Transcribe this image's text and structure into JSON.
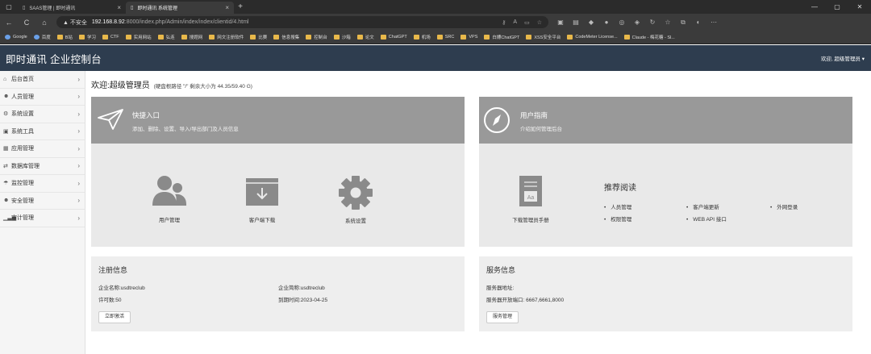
{
  "browser": {
    "tabs": [
      {
        "title": "SAAS管理 | 即时通讯",
        "close": "×"
      },
      {
        "title": "即时通讯 系统管理",
        "close": "×"
      }
    ],
    "new_tab": "+",
    "window_controls": [
      "—",
      "▢",
      "✕"
    ],
    "nav": {
      "back": "←",
      "refresh": "C",
      "home": "⌂"
    },
    "url": {
      "warning": "▲ 不安全",
      "host": "192.168.8.92",
      "path": ":8000/index.php/Admin/index/index/clientid/4.html"
    },
    "bookmarks": [
      "Google",
      "百度",
      "B站",
      "学习",
      "CTF",
      "实用网站",
      "弘连",
      "搜题网",
      "网文注册软件",
      "比赛",
      "信息搜集",
      "控制台",
      "沙箱",
      "论文",
      "ChatGPT",
      "机场",
      "SRC",
      "VPS",
      "白嫖ChatGPT",
      "XSS安全平台",
      "CodeMeter License...",
      "Claude - 梅花糖 - Sl..."
    ]
  },
  "header": {
    "brand": "即时通讯 企业控制台",
    "user": "欢迎, 超级管理员 ▾"
  },
  "sidebar": {
    "items": [
      {
        "icon": "home-icon",
        "glyph": "⌂",
        "label": "后台首页"
      },
      {
        "icon": "users-icon",
        "glyph": "☻",
        "label": "人员管理"
      },
      {
        "icon": "gears-icon",
        "glyph": "⚙",
        "label": "系统设置"
      },
      {
        "icon": "briefcase-icon",
        "glyph": "▣",
        "label": "系统工具"
      },
      {
        "icon": "grid-icon",
        "glyph": "▦",
        "label": "应用管理"
      },
      {
        "icon": "exchange-icon",
        "glyph": "⇄",
        "label": "数据库管理"
      },
      {
        "icon": "umbrella-icon",
        "glyph": "☂",
        "label": "监控管理"
      },
      {
        "icon": "group-icon",
        "glyph": "☻",
        "label": "安全管理"
      },
      {
        "icon": "bar-chart-icon",
        "glyph": "▁▃▅",
        "label": "审计管理"
      }
    ],
    "chevron": "›"
  },
  "welcome": {
    "title": "欢迎:超级管理员",
    "disk": "(硬盘根路径 \"/\" 剩余大小为 44.35/59.40 G)"
  },
  "quick": {
    "title": "快捷入口",
    "subtitle": "添加、删除、设置、导入/导出部门及人员信息",
    "items": [
      {
        "icon": "users-large-icon",
        "label": "用户管理"
      },
      {
        "icon": "download-box-icon",
        "label": "客户端下载"
      },
      {
        "icon": "gear-large-icon",
        "label": "系统设置"
      }
    ]
  },
  "guide": {
    "title": "用户指南",
    "subtitle": "介绍如何管理后台",
    "manual_label": "下载管理员手册",
    "manual_icon_text": "Aa",
    "reading_title": "推荐阅读",
    "links": [
      "人员管理",
      "客户端更新",
      "外网登录",
      "权限管理",
      "WEB API 接口"
    ]
  },
  "registration": {
    "title": "注册信息",
    "company_name": "企业名称:usdtreclub",
    "company_short": "企业简称:usdtreclub",
    "license_count": "许可数:50",
    "expire": "到期时间:2023-04-25",
    "button": "立即激活"
  },
  "server": {
    "title": "服务信息",
    "address": "服务器地址:",
    "ports": "服务器开放端口:  6667,6661,8000",
    "button": "服务管理"
  },
  "colors": {
    "header_bg": "#2e3d4f",
    "panel_head": "#999999",
    "panel_body": "#e9e9e9",
    "icon_gray": "#8a8a8a"
  }
}
